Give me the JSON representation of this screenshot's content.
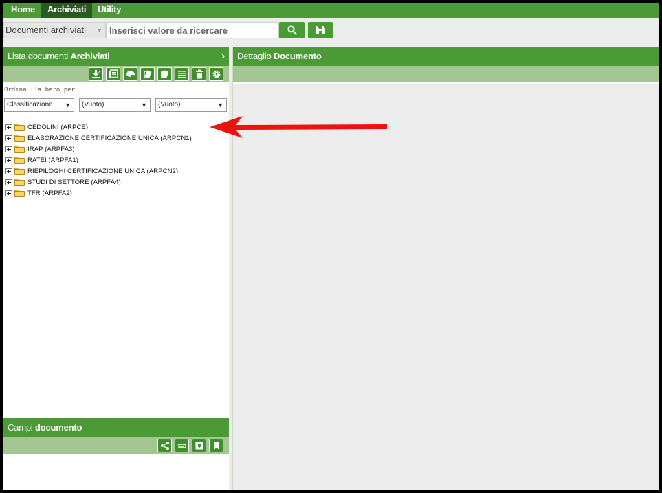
{
  "nav": {
    "tabs": [
      {
        "label": "Home"
      },
      {
        "label": "Archiviati"
      },
      {
        "label": "Utility"
      }
    ]
  },
  "search": {
    "scope_value": "Documenti archiviati",
    "placeholder": "Inserisci valore da ricercare",
    "search_icon": "magnifier-icon",
    "binoculars_icon": "binoculars-icon"
  },
  "left_panel": {
    "title_prefix": "Lista documenti ",
    "title_bold": "Archiviati",
    "toolbar_icons": [
      "download-icon",
      "list-doc-icon",
      "cloud-icon",
      "export-cards-icon",
      "cards-icon",
      "lines-icon",
      "trash-icon",
      "gear-icon"
    ],
    "sort_label": "Ordina l'albero per",
    "sort_selects": [
      "Classificazione",
      "(Vuoto)",
      "(Vuoto)"
    ],
    "tree_items": [
      "CEDOLINI (ARPCE)",
      "ELABORAZIONE CERTIFICAZIONE UNICA (ARPCN1)",
      "IRAP (ARPFA3)",
      "RATEI (ARPFA1)",
      "RIEPILOGHI CERTIFICAZIONE UNICA (ARPCN2)",
      "STUDI DI SETTORE (ARPFA4)",
      "TFR (ARPFA2)"
    ]
  },
  "campi": {
    "title_prefix": "Campi ",
    "title_bold": "documento",
    "toolbar_icons": [
      "share-icon",
      "paperclip-icon",
      "save-icon",
      "bookmark-icon"
    ]
  },
  "right_panel": {
    "title_prefix": "Dettaglio ",
    "title_bold": "Documento"
  },
  "colors": {
    "brand_green": "#4a9a36",
    "toolbar_green": "#a4c692",
    "active_tab": "#2b5a20",
    "annotation_red": "#ee1111"
  }
}
